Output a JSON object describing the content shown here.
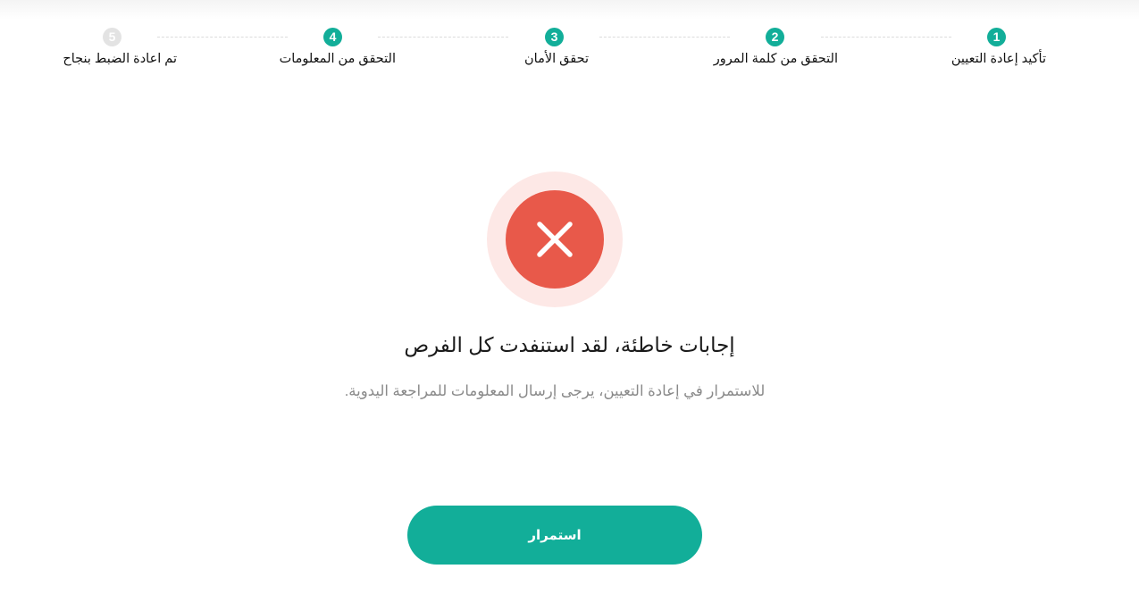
{
  "stepper": {
    "steps": [
      {
        "number": "1",
        "label": "تأكيد إعادة التعيين",
        "state": "done"
      },
      {
        "number": "2",
        "label": "التحقق من كلمة المرور",
        "state": "done"
      },
      {
        "number": "3",
        "label": "تحقق الأمان",
        "state": "done"
      },
      {
        "number": "4",
        "label": "التحقق من المعلومات",
        "state": "done"
      },
      {
        "number": "5",
        "label": "تم اعادة الضبط بنجاح",
        "state": "pending"
      }
    ]
  },
  "status": {
    "icon": "error-x-icon",
    "title": "إجابات خاطئة، لقد استنفدت كل الفرص",
    "message": "للاستمرار في إعادة التعيين، يرجى إرسال المعلومات للمراجعة اليدوية."
  },
  "actions": {
    "continue_label": "استمرار"
  },
  "colors": {
    "accent": "#12ae99",
    "error": "#e8594a",
    "error_halo": "#fde8e6",
    "pending": "#e3e3e3"
  }
}
